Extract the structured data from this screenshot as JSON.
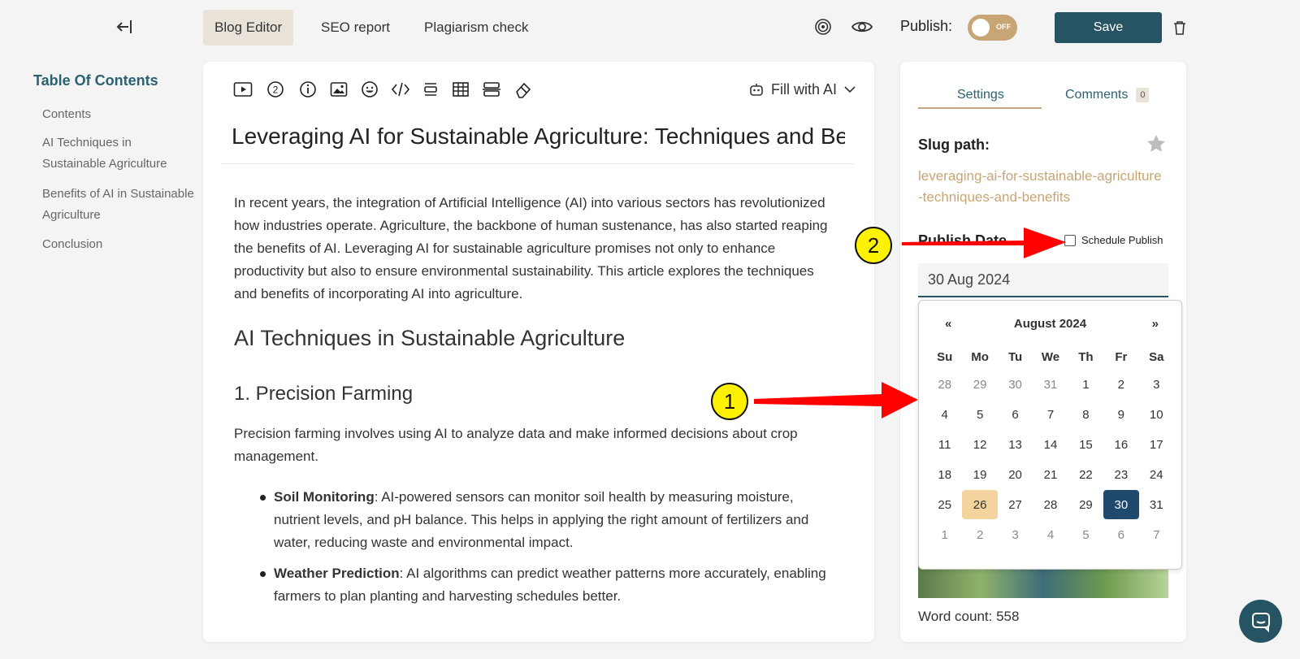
{
  "topbar": {
    "tabs": [
      {
        "label": "Blog Editor",
        "active": true
      },
      {
        "label": "SEO report",
        "active": false
      },
      {
        "label": "Plagiarism check",
        "active": false
      }
    ],
    "publish_label": "Publish:",
    "toggle_text": "OFF",
    "save_label": "Save"
  },
  "toc": {
    "title": "Table Of Contents",
    "items": [
      "Contents",
      "AI Techniques in Sustainable Agriculture",
      "Benefits of AI in Sustainable Agriculture",
      "Conclusion"
    ]
  },
  "editor": {
    "fill_ai_label": "Fill with AI",
    "title": "Leveraging AI for Sustainable Agriculture: Techniques and Benefits",
    "intro": "In recent years, the integration of Artificial Intelligence (AI) into various sectors has revolutionized how industries operate. Agriculture, the backbone of human sustenance, has also started reaping the benefits of AI. Leveraging AI for sustainable agriculture promises not only to enhance productivity but also to ensure environmental sustainability. This article explores the techniques and benefits of incorporating AI into agriculture.",
    "h2": "AI Techniques in Sustainable Agriculture",
    "h3": "1. Precision Farming",
    "para": "Precision farming involves using AI to analyze data and make informed decisions about crop management.",
    "bullets": [
      {
        "bold": "Soil Monitoring",
        "text": ": AI-powered sensors can monitor soil health by measuring moisture, nutrient levels, and pH balance. This helps in applying the right amount of fertilizers and water, reducing waste and environmental impact."
      },
      {
        "bold": "Weather Prediction",
        "text": ": AI algorithms can predict weather patterns more accurately, enabling farmers to plan planting and harvesting schedules better."
      }
    ]
  },
  "panel": {
    "tab_settings": "Settings",
    "tab_comments": "Comments",
    "comments_count": "0",
    "slug_label": "Slug path:",
    "slug_value": "leveraging-ai-for-sustainable-agriculture-techniques-and-benefits",
    "publish_date_label": "Publish Date",
    "schedule_label": "Schedule Publish",
    "date_value": "30 Aug 2024",
    "word_count": "Word count: 558"
  },
  "calendar": {
    "month_label": "August 2024",
    "prev": "«",
    "next": "»",
    "weekdays": [
      "Su",
      "Mo",
      "Tu",
      "We",
      "Th",
      "Fr",
      "Sa"
    ],
    "days": [
      [
        "28",
        "29",
        "30",
        "31",
        "1",
        "2",
        "3"
      ],
      [
        "4",
        "5",
        "6",
        "7",
        "8",
        "9",
        "10"
      ],
      [
        "11",
        "12",
        "13",
        "14",
        "15",
        "16",
        "17"
      ],
      [
        "18",
        "19",
        "20",
        "21",
        "22",
        "23",
        "24"
      ],
      [
        "25",
        "26",
        "27",
        "28",
        "29",
        "30",
        "31"
      ],
      [
        "1",
        "2",
        "3",
        "4",
        "5",
        "6",
        "7"
      ]
    ],
    "today": "26",
    "selected": "30"
  },
  "annotations": {
    "badge1": "1",
    "badge2": "2"
  },
  "colors": {
    "accent": "#275462",
    "gold": "#c8a574",
    "today": "#f5d39f",
    "selected": "#1f4a6e",
    "arrow": "#ff0000"
  }
}
